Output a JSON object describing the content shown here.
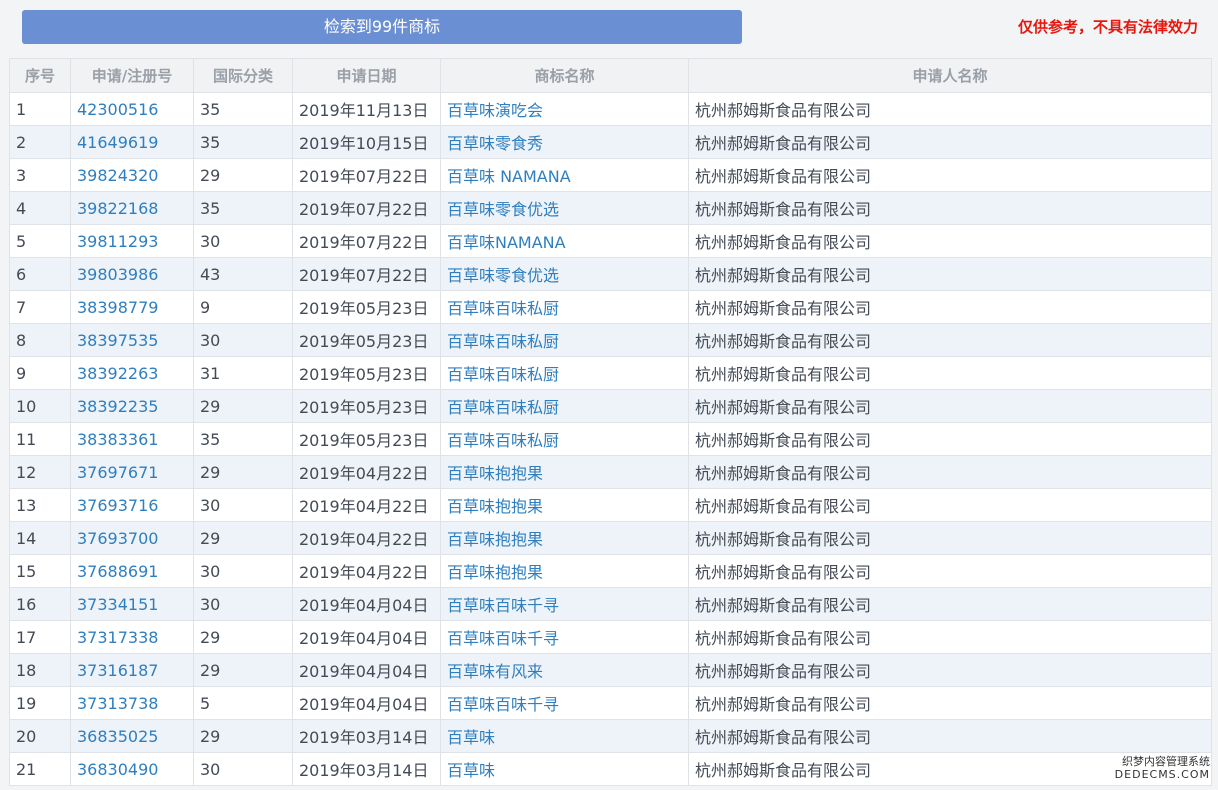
{
  "header": {
    "result_label": "检索到99件商标",
    "disclaimer": "仅供参考，不具有法律效力"
  },
  "table": {
    "columns": [
      "序号",
      "申请/注册号",
      "国际分类",
      "申请日期",
      "商标名称",
      "申请人名称"
    ],
    "rows": [
      [
        "1",
        "42300516",
        "35",
        "2019年11月13日",
        "百草味演吃会",
        "杭州郝姆斯食品有限公司"
      ],
      [
        "2",
        "41649619",
        "35",
        "2019年10月15日",
        "百草味零食秀",
        "杭州郝姆斯食品有限公司"
      ],
      [
        "3",
        "39824320",
        "29",
        "2019年07月22日",
        "百草味 NAMANA",
        "杭州郝姆斯食品有限公司"
      ],
      [
        "4",
        "39822168",
        "35",
        "2019年07月22日",
        "百草味零食优选",
        "杭州郝姆斯食品有限公司"
      ],
      [
        "5",
        "39811293",
        "30",
        "2019年07月22日",
        "百草味NAMANA",
        "杭州郝姆斯食品有限公司"
      ],
      [
        "6",
        "39803986",
        "43",
        "2019年07月22日",
        "百草味零食优选",
        "杭州郝姆斯食品有限公司"
      ],
      [
        "7",
        "38398779",
        "9",
        "2019年05月23日",
        "百草味百味私厨",
        "杭州郝姆斯食品有限公司"
      ],
      [
        "8",
        "38397535",
        "30",
        "2019年05月23日",
        "百草味百味私厨",
        "杭州郝姆斯食品有限公司"
      ],
      [
        "9",
        "38392263",
        "31",
        "2019年05月23日",
        "百草味百味私厨",
        "杭州郝姆斯食品有限公司"
      ],
      [
        "10",
        "38392235",
        "29",
        "2019年05月23日",
        "百草味百味私厨",
        "杭州郝姆斯食品有限公司"
      ],
      [
        "11",
        "38383361",
        "35",
        "2019年05月23日",
        "百草味百味私厨",
        "杭州郝姆斯食品有限公司"
      ],
      [
        "12",
        "37697671",
        "29",
        "2019年04月22日",
        "百草味抱抱果",
        "杭州郝姆斯食品有限公司"
      ],
      [
        "13",
        "37693716",
        "30",
        "2019年04月22日",
        "百草味抱抱果",
        "杭州郝姆斯食品有限公司"
      ],
      [
        "14",
        "37693700",
        "29",
        "2019年04月22日",
        "百草味抱抱果",
        "杭州郝姆斯食品有限公司"
      ],
      [
        "15",
        "37688691",
        "30",
        "2019年04月22日",
        "百草味抱抱果",
        "杭州郝姆斯食品有限公司"
      ],
      [
        "16",
        "37334151",
        "30",
        "2019年04月04日",
        "百草味百味千寻",
        "杭州郝姆斯食品有限公司"
      ],
      [
        "17",
        "37317338",
        "29",
        "2019年04月04日",
        "百草味百味千寻",
        "杭州郝姆斯食品有限公司"
      ],
      [
        "18",
        "37316187",
        "29",
        "2019年04月04日",
        "百草味有风来",
        "杭州郝姆斯食品有限公司"
      ],
      [
        "19",
        "37313738",
        "5",
        "2019年04月04日",
        "百草味百味千寻",
        "杭州郝姆斯食品有限公司"
      ],
      [
        "20",
        "36835025",
        "29",
        "2019年03月14日",
        "百草味",
        "杭州郝姆斯食品有限公司"
      ],
      [
        "21",
        "36830490",
        "30",
        "2019年03月14日",
        "百草味",
        "杭州郝姆斯食品有限公司"
      ]
    ]
  },
  "watermark": {
    "line1": "织梦内容管理系统",
    "line2": "DEDECMS.COM"
  },
  "colors": {
    "button_bg": "#6b8fd3",
    "disclaimer": "#e8170e",
    "link": "#2f7fc0",
    "row_alt": "#eef3f9"
  }
}
